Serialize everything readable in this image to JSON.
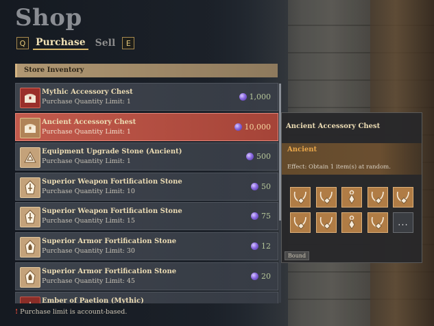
{
  "screen": {
    "title": "Shop"
  },
  "tabs": [
    {
      "key": "Q"
    },
    {
      "label": "Purchase",
      "active": true
    },
    {
      "label": "Sell",
      "active": false
    },
    {
      "key": "E"
    }
  ],
  "inventory": {
    "header": "Store Inventory",
    "items": [
      {
        "name": "Mythic Accessory Chest",
        "limit": "Purchase Quantity Limit: 1",
        "price": "1,000",
        "icon": "chest-icon",
        "selected": false
      },
      {
        "name": "Ancient Accessory Chest",
        "limit": "Purchase Quantity Limit: 1",
        "price": "10,000",
        "icon": "chest-icon",
        "selected": true
      },
      {
        "name": "Equipment Upgrade Stone (Ancient)",
        "limit": "Purchase Quantity Limit: 1",
        "price": "500",
        "icon": "upgrade-stone-icon",
        "selected": false
      },
      {
        "name": "Superior Weapon Fortification Stone",
        "limit": "Purchase Quantity Limit: 10",
        "price": "50",
        "icon": "weapon-stone-icon",
        "selected": false
      },
      {
        "name": "Superior Weapon Fortification Stone",
        "limit": "Purchase Quantity Limit: 15",
        "price": "75",
        "icon": "weapon-stone-icon",
        "selected": false
      },
      {
        "name": "Superior Armor Fortification Stone",
        "limit": "Purchase Quantity Limit: 30",
        "price": "12",
        "icon": "armor-stone-icon",
        "selected": false
      },
      {
        "name": "Superior Armor Fortification Stone",
        "limit": "Purchase Quantity Limit: 45",
        "price": "20",
        "icon": "armor-stone-icon",
        "selected": false
      },
      {
        "name": "Ember of Paetion (Mythic)",
        "limit": "",
        "price": "",
        "icon": "ember-icon",
        "selected": false
      }
    ]
  },
  "notice": "Purchase limit is account-based.",
  "tooltip": {
    "title": "Ancient Accessory Chest",
    "grade": "Ancient",
    "effect": "Effect: Obtain 1 item(s) at random.",
    "slots": [
      "necklace-icon",
      "necklace-icon",
      "earring-icon",
      "necklace-icon",
      "necklace-icon",
      "necklace-icon",
      "necklace-icon",
      "earring-icon",
      "necklace-icon"
    ],
    "more_label": "...",
    "bound": "Bound"
  },
  "colors": {
    "accent": "#d9b767",
    "selected_row": "#c25a4c",
    "grade_ancient": "#e8a64a",
    "price": "#b7c79a"
  }
}
